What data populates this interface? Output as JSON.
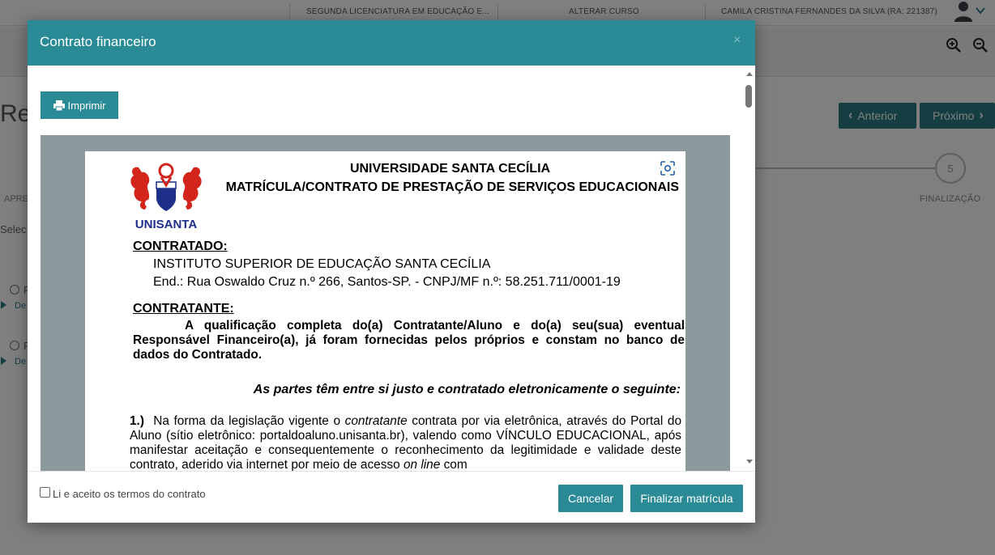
{
  "topbar": {
    "course": "SEGUNDA LICENCIATURA EM EDUCAÇÃO E...",
    "change_course": "ALTERAR CURSO",
    "user": "CAMILA CRISTINA FERNANDES DA SILVA (RA: 221387)"
  },
  "background": {
    "title": "Re",
    "prev_label": "Anterior",
    "next_label": "Próximo",
    "step_number": "5",
    "step_label": "FINALIZAÇÃO",
    "left_step": "APRE",
    "select_text": "Selec",
    "radio1_label": "P",
    "radio1_detail": "De",
    "radio2_label": "P",
    "radio2_detail": "De"
  },
  "modal": {
    "title": "Contrato financeiro",
    "close": "×",
    "print_label": "Imprimir",
    "terms_label": "Li e aceito os termos do contrato",
    "cancel_label": "Cancelar",
    "finish_label": "Finalizar matrícula"
  },
  "document": {
    "logo_text": "UNISANTA",
    "heading1": "UNIVERSIDADE SANTA CECÍLIA",
    "heading2": "MATRÍCULA/CONTRATO DE PRESTAÇÃO DE SERVIÇOS EDUCACIONAIS",
    "contratado_label": "CONTRATADO:",
    "contratado_name": "INSTITUTO SUPERIOR DE EDUCAÇÃO SANTA CECÍLIA",
    "contratado_address": "End.: Rua Oswaldo Cruz n.º 266, Santos-SP.  - CNPJ/MF n.º: 58.251.711/0001-19",
    "contratante_label": "CONTRATANTE:",
    "contratante_text": "A qualificação completa do(a) Contratante/Aluno e do(a) seu(sua) eventual Responsável Financeiro(a), já foram fornecidas pelos próprios e constam no banco de dados do Contratado.",
    "parties_text": "As partes têm entre si justo e contratado eletronicamente o seguinte:",
    "clause1_number": "1.)",
    "clause1_a": "Na  forma da legislação vigente o",
    "clause1_italic": "contratante",
    "clause1_b": "contrata por via eletrônica, através do Portal do Aluno (sítio eletrônico: portaldoaluno.unisanta.br), valendo como VÍNCULO EDUCACIONAL, após manifestar aceitação e consequentemente o reconhecimento da legitimidade e validade deste contrato, aderido via internet por meio de acesso",
    "clause1_italic2": "on line",
    "clause1_c": "com"
  },
  "colors": {
    "accent": "#2a8a95",
    "nav_button": "#2a7c87",
    "logo_red": "#d4251c",
    "logo_blue": "#1e2f8a"
  }
}
